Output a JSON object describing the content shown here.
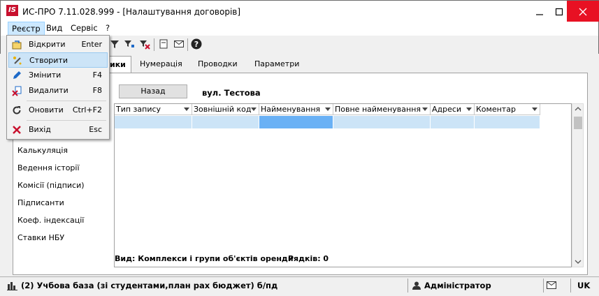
{
  "window": {
    "logo_text": "IS",
    "title": "ИС-ПРО 7.11.028.999 - [Налаштування договорів]"
  },
  "menu": {
    "items": [
      "Реєстр",
      "Вид",
      "Сервіс",
      "?"
    ]
  },
  "dropdown": {
    "items": [
      {
        "label": "Відкрити",
        "shortcut": "Enter",
        "icon": "open-icon"
      },
      {
        "label": "Створити",
        "shortcut": "",
        "icon": "create-icon"
      },
      {
        "label": "Змінити",
        "shortcut": "F4",
        "icon": "edit-icon"
      },
      {
        "label": "Видалити",
        "shortcut": "F8",
        "icon": "delete-icon"
      },
      {
        "label": "Оновити",
        "shortcut": "Ctrl+F2",
        "icon": "refresh-icon"
      },
      {
        "label": "Вихід",
        "shortcut": "Esc",
        "icon": "exit-icon"
      }
    ]
  },
  "tabs": {
    "active_suffix": "ики",
    "items": [
      "Нумерація",
      "Проводки",
      "Параметри"
    ]
  },
  "sidebar": {
    "items": [
      "Калькуляція",
      "Ведення історії",
      "Комісії (підписи)",
      "Підписанти",
      "Коеф. індексації",
      "Ставки НБУ"
    ]
  },
  "panel": {
    "back_label": "Назад",
    "address": "вул. Тестова"
  },
  "grid": {
    "columns": [
      "Тип запису",
      "Зовнішній код",
      "Найменування",
      "Повне найменування",
      "Адреси",
      "Коментар"
    ]
  },
  "footer": {
    "view_label": "Вид: Комплекси і групи об'єктів оренди",
    "rows_label": "Рядків: 0"
  },
  "statusbar": {
    "database": "(2) Учбова база (зі студентами,план рах бюджет) б/пд",
    "user": "Адміністратор",
    "lang": "UK"
  },
  "colors": {
    "logo": "#c8102e",
    "close_button": "#e81123",
    "selection": "#6ab1f5",
    "row_highlight": "#cce4f7"
  }
}
